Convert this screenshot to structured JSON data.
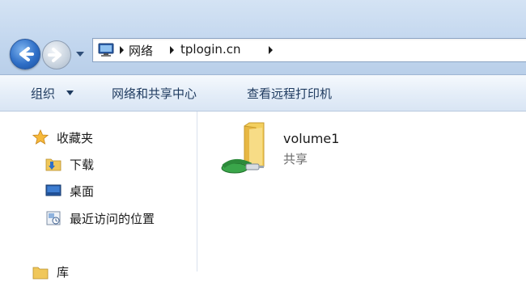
{
  "address_bar": {
    "breadcrumbs": [
      "网络",
      "tplogin.cn"
    ],
    "icon": "network-computer-icon"
  },
  "nav": {
    "back_icon": "back-arrow-icon",
    "forward_icon": "forward-arrow-icon",
    "history_icon": "chevron-down-icon"
  },
  "toolbar": {
    "organize_label": "组织",
    "network_center_label": "网络和共享中心",
    "printers_label": "查看远程打印机"
  },
  "sidebar": {
    "items": [
      {
        "label": "收藏夹",
        "icon": "star-icon"
      },
      {
        "label": "下载",
        "icon": "download-folder-icon"
      },
      {
        "label": "桌面",
        "icon": "desktop-icon"
      },
      {
        "label": "最近访问的位置",
        "icon": "recent-places-icon"
      },
      {
        "label": "库",
        "icon": "library-icon"
      }
    ]
  },
  "content": {
    "items": [
      {
        "name": "volume1",
        "type": "共享",
        "icon": "shared-folder-icon"
      }
    ]
  },
  "colors": {
    "titlebar": "#c2d6ee",
    "toolbar_text": "#1e3a5f",
    "back_button": "#2f6fc7",
    "share_green": "#3aa64a",
    "folder_yellow": "#f3cf5e"
  }
}
